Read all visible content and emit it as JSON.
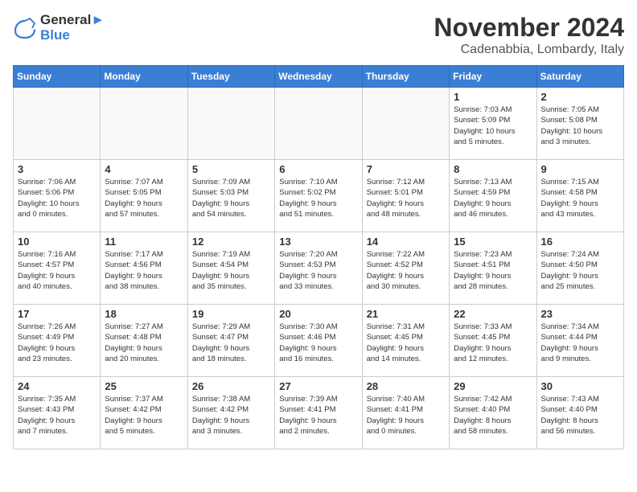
{
  "header": {
    "logo_line1": "General",
    "logo_line2": "Blue",
    "month": "November 2024",
    "location": "Cadenabbia, Lombardy, Italy"
  },
  "weekdays": [
    "Sunday",
    "Monday",
    "Tuesday",
    "Wednesday",
    "Thursday",
    "Friday",
    "Saturday"
  ],
  "weeks": [
    [
      {
        "day": "",
        "info": ""
      },
      {
        "day": "",
        "info": ""
      },
      {
        "day": "",
        "info": ""
      },
      {
        "day": "",
        "info": ""
      },
      {
        "day": "",
        "info": ""
      },
      {
        "day": "1",
        "info": "Sunrise: 7:03 AM\nSunset: 5:09 PM\nDaylight: 10 hours\nand 5 minutes."
      },
      {
        "day": "2",
        "info": "Sunrise: 7:05 AM\nSunset: 5:08 PM\nDaylight: 10 hours\nand 3 minutes."
      }
    ],
    [
      {
        "day": "3",
        "info": "Sunrise: 7:06 AM\nSunset: 5:06 PM\nDaylight: 10 hours\nand 0 minutes."
      },
      {
        "day": "4",
        "info": "Sunrise: 7:07 AM\nSunset: 5:05 PM\nDaylight: 9 hours\nand 57 minutes."
      },
      {
        "day": "5",
        "info": "Sunrise: 7:09 AM\nSunset: 5:03 PM\nDaylight: 9 hours\nand 54 minutes."
      },
      {
        "day": "6",
        "info": "Sunrise: 7:10 AM\nSunset: 5:02 PM\nDaylight: 9 hours\nand 51 minutes."
      },
      {
        "day": "7",
        "info": "Sunrise: 7:12 AM\nSunset: 5:01 PM\nDaylight: 9 hours\nand 48 minutes."
      },
      {
        "day": "8",
        "info": "Sunrise: 7:13 AM\nSunset: 4:59 PM\nDaylight: 9 hours\nand 46 minutes."
      },
      {
        "day": "9",
        "info": "Sunrise: 7:15 AM\nSunset: 4:58 PM\nDaylight: 9 hours\nand 43 minutes."
      }
    ],
    [
      {
        "day": "10",
        "info": "Sunrise: 7:16 AM\nSunset: 4:57 PM\nDaylight: 9 hours\nand 40 minutes."
      },
      {
        "day": "11",
        "info": "Sunrise: 7:17 AM\nSunset: 4:56 PM\nDaylight: 9 hours\nand 38 minutes."
      },
      {
        "day": "12",
        "info": "Sunrise: 7:19 AM\nSunset: 4:54 PM\nDaylight: 9 hours\nand 35 minutes."
      },
      {
        "day": "13",
        "info": "Sunrise: 7:20 AM\nSunset: 4:53 PM\nDaylight: 9 hours\nand 33 minutes."
      },
      {
        "day": "14",
        "info": "Sunrise: 7:22 AM\nSunset: 4:52 PM\nDaylight: 9 hours\nand 30 minutes."
      },
      {
        "day": "15",
        "info": "Sunrise: 7:23 AM\nSunset: 4:51 PM\nDaylight: 9 hours\nand 28 minutes."
      },
      {
        "day": "16",
        "info": "Sunrise: 7:24 AM\nSunset: 4:50 PM\nDaylight: 9 hours\nand 25 minutes."
      }
    ],
    [
      {
        "day": "17",
        "info": "Sunrise: 7:26 AM\nSunset: 4:49 PM\nDaylight: 9 hours\nand 23 minutes."
      },
      {
        "day": "18",
        "info": "Sunrise: 7:27 AM\nSunset: 4:48 PM\nDaylight: 9 hours\nand 20 minutes."
      },
      {
        "day": "19",
        "info": "Sunrise: 7:29 AM\nSunset: 4:47 PM\nDaylight: 9 hours\nand 18 minutes."
      },
      {
        "day": "20",
        "info": "Sunrise: 7:30 AM\nSunset: 4:46 PM\nDaylight: 9 hours\nand 16 minutes."
      },
      {
        "day": "21",
        "info": "Sunrise: 7:31 AM\nSunset: 4:45 PM\nDaylight: 9 hours\nand 14 minutes."
      },
      {
        "day": "22",
        "info": "Sunrise: 7:33 AM\nSunset: 4:45 PM\nDaylight: 9 hours\nand 12 minutes."
      },
      {
        "day": "23",
        "info": "Sunrise: 7:34 AM\nSunset: 4:44 PM\nDaylight: 9 hours\nand 9 minutes."
      }
    ],
    [
      {
        "day": "24",
        "info": "Sunrise: 7:35 AM\nSunset: 4:43 PM\nDaylight: 9 hours\nand 7 minutes."
      },
      {
        "day": "25",
        "info": "Sunrise: 7:37 AM\nSunset: 4:42 PM\nDaylight: 9 hours\nand 5 minutes."
      },
      {
        "day": "26",
        "info": "Sunrise: 7:38 AM\nSunset: 4:42 PM\nDaylight: 9 hours\nand 3 minutes."
      },
      {
        "day": "27",
        "info": "Sunrise: 7:39 AM\nSunset: 4:41 PM\nDaylight: 9 hours\nand 2 minutes."
      },
      {
        "day": "28",
        "info": "Sunrise: 7:40 AM\nSunset: 4:41 PM\nDaylight: 9 hours\nand 0 minutes."
      },
      {
        "day": "29",
        "info": "Sunrise: 7:42 AM\nSunset: 4:40 PM\nDaylight: 8 hours\nand 58 minutes."
      },
      {
        "day": "30",
        "info": "Sunrise: 7:43 AM\nSunset: 4:40 PM\nDaylight: 8 hours\nand 56 minutes."
      }
    ]
  ]
}
